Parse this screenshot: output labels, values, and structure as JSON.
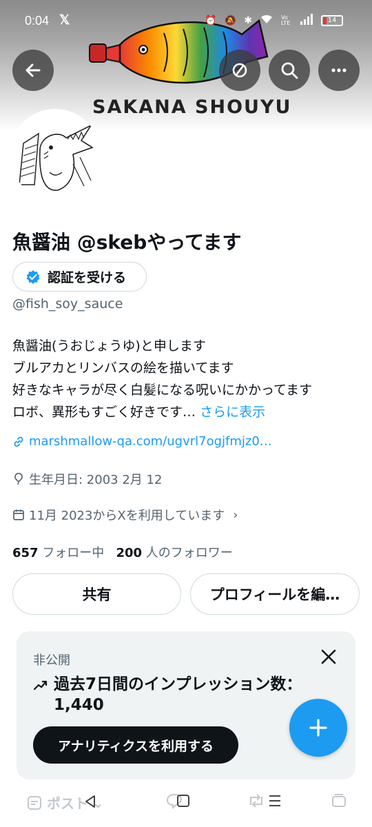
{
  "status": {
    "time": "0:04",
    "x_logo": "𝕏",
    "volte": "Vo LTE",
    "battery": "14"
  },
  "banner": {
    "text": "SAKANA SHOUYU"
  },
  "nav": {
    "back": "back-arrow",
    "search": "search",
    "more": "more"
  },
  "profile": {
    "name": "魚醤油 @skebやってます",
    "verify_label": "認証を受ける",
    "handle": "@fish_soy_sauce",
    "bio_lines": [
      "魚醤油(うおじょうゆ)と申します",
      "ブルアカとリンバスの絵を描いてます",
      "好きなキャラが尽く白髪になる呪いにかかってます",
      "ロボ、異形もすごく好きです…"
    ],
    "show_more": "さらに表示",
    "link": "marshmallow-qa.com/ugvrl7ogjfmjz0…",
    "birthday": "生年月日: 2003 2月 12",
    "joined": "11月 2023からXを利用しています",
    "following_count": "657",
    "following_label": "フォロー中",
    "followers_count": "200",
    "followers_label": "人のフォロワー"
  },
  "actions": {
    "share": "共有",
    "edit_profile": "プロフィールを編…"
  },
  "impressions": {
    "private_label": "非公開",
    "title": "過去7日間のインプレッション数：",
    "count": "1,440",
    "analytics_button": "アナリティクスを利用する"
  },
  "tabbar": {
    "post_label": "ポスト"
  }
}
